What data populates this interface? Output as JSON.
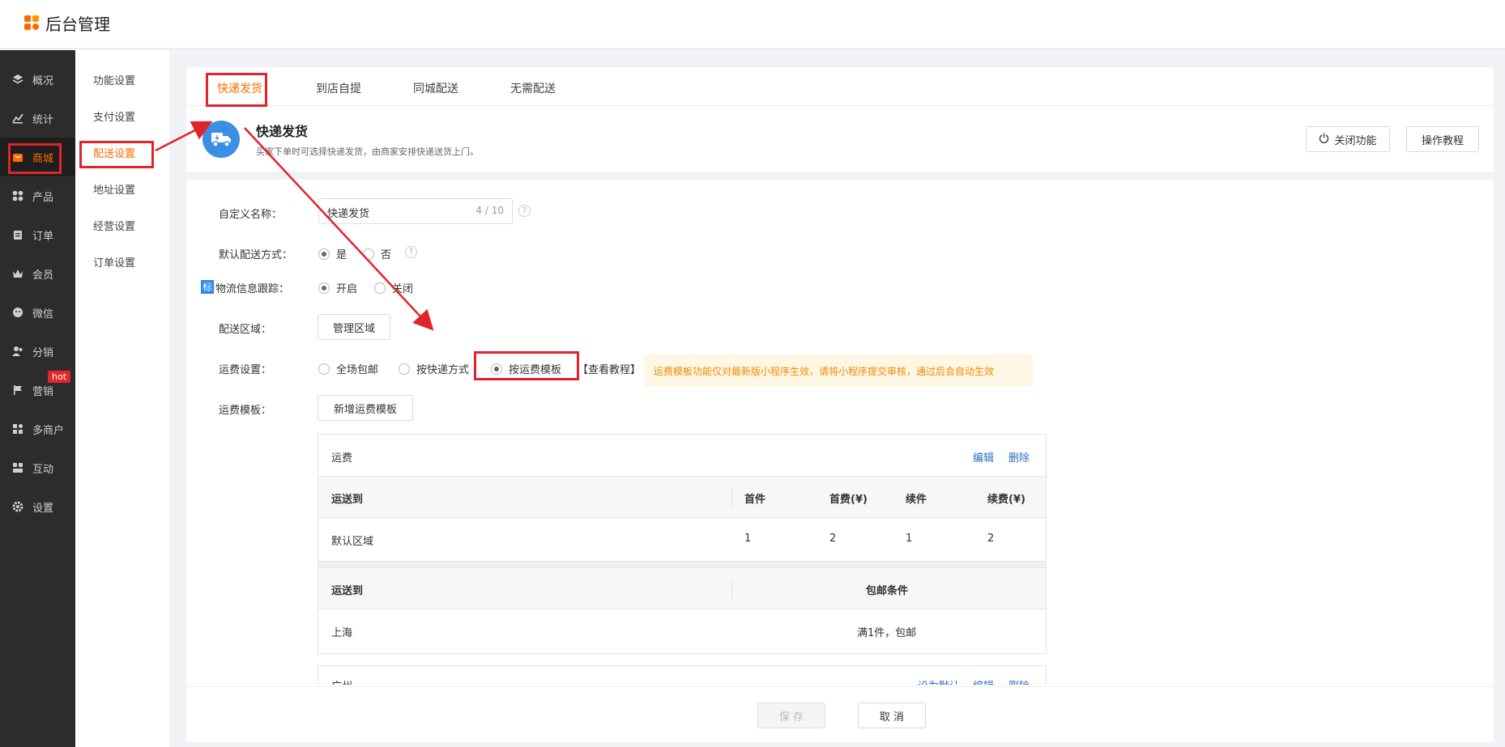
{
  "app": {
    "title": "后台管理"
  },
  "sidebar": {
    "items": [
      {
        "label": "概况",
        "icon": "layers-icon"
      },
      {
        "label": "统计",
        "icon": "chart-icon"
      },
      {
        "label": "商城",
        "icon": "shop-icon"
      },
      {
        "label": "产品",
        "icon": "grid-icon"
      },
      {
        "label": "订单",
        "icon": "clipboard-icon"
      },
      {
        "label": "会员",
        "icon": "crown-icon"
      },
      {
        "label": "微信",
        "icon": "wechat-icon"
      },
      {
        "label": "分销",
        "icon": "users-icon"
      },
      {
        "label": "营销",
        "icon": "flag-icon"
      },
      {
        "label": "多商户",
        "icon": "store-icon"
      },
      {
        "label": "互动",
        "icon": "people-icon"
      },
      {
        "label": "设置",
        "icon": "gear-icon"
      }
    ],
    "hot_badge": "hot"
  },
  "subsidebar": {
    "items": [
      "功能设置",
      "支付设置",
      "配送设置",
      "地址设置",
      "经营设置",
      "订单设置"
    ]
  },
  "tabs": [
    "快递发货",
    "到店自提",
    "同城配送",
    "无需配送"
  ],
  "header": {
    "title": "快递发货",
    "desc": "买家下单时可选择快递发货，由商家安排快递送货上门。",
    "close_btn": "关闭功能",
    "tutorial_btn": "操作教程"
  },
  "form": {
    "name_label": "自定义名称：",
    "name_value": "快递发货",
    "name_count": "4 / 10",
    "default_label": "默认配送方式：",
    "yes": "是",
    "no": "否",
    "tag": "标",
    "tracking_label": "物流信息跟踪：",
    "on": "开启",
    "off": "关闭",
    "region_label": "配送区域：",
    "region_btn": "管理区域",
    "fee_label": "运费设置：",
    "fee_opt1": "全场包邮",
    "fee_opt2": "按快递方式",
    "fee_opt3": "按运费模板",
    "fee_tutorial": "【查看教程】",
    "fee_notice": "运费模板功能仅对最新版小程序生效，请将小程序提交审核，通过后会自动生效",
    "template_label": "运费模板：",
    "template_btn": "新增运费模板"
  },
  "template_table": {
    "name": "运费",
    "edit": "编辑",
    "delete": "删除",
    "headers": [
      "运送到",
      "首件",
      "首费(¥)",
      "续件",
      "续费(¥)"
    ],
    "row": [
      "默认区域",
      "1",
      "2",
      "1",
      "2"
    ],
    "free_headers": [
      "运送到",
      "包邮条件"
    ],
    "free_row": [
      "上海",
      "满1件，包邮"
    ]
  },
  "template_table2": {
    "name": "广州",
    "default_link": "设为默认",
    "edit": "编辑",
    "delete": "删除"
  },
  "footer": {
    "save": "保 存",
    "cancel": "取 消"
  }
}
